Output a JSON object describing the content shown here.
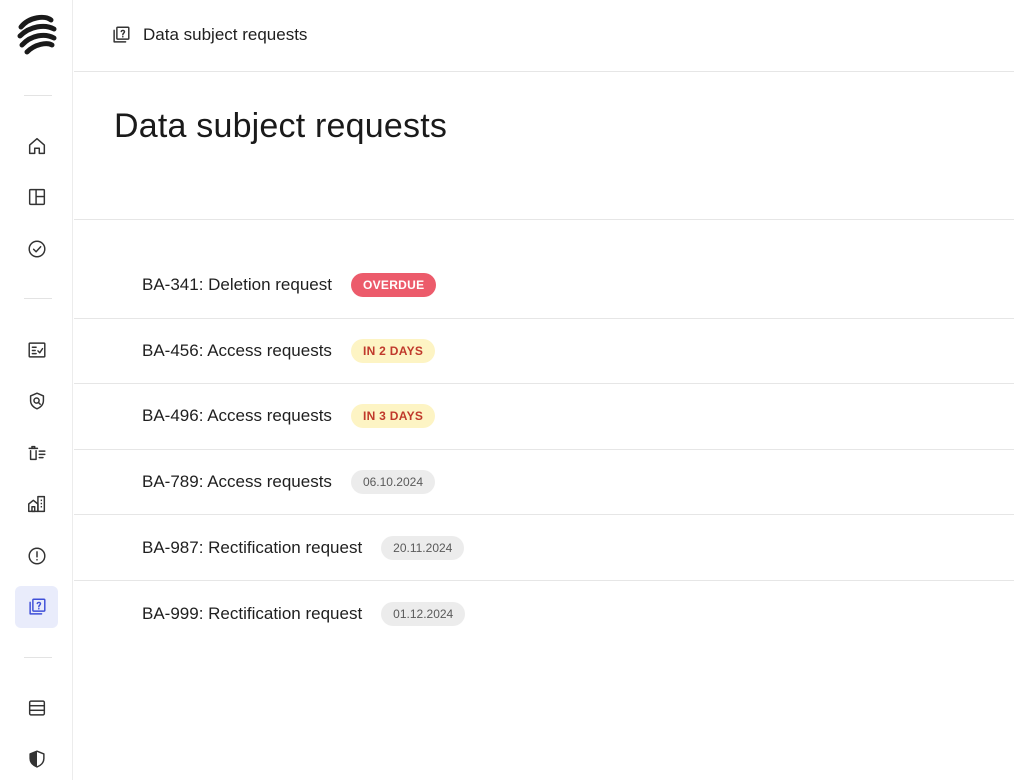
{
  "breadcrumb": {
    "label": "Data subject requests"
  },
  "page": {
    "title": "Data subject requests"
  },
  "colors": {
    "overdue_badge": "#ec5b6b",
    "soon_badge_bg": "#fdf4c4",
    "soon_badge_text": "#c0392b",
    "date_badge_bg": "#ececec",
    "active_nav_bg": "#e9ecfb",
    "accent": "#3f4fd8"
  },
  "sidebar": {
    "items": [
      {
        "icon": "home-icon"
      },
      {
        "icon": "layout-icon"
      },
      {
        "icon": "check-circle-icon"
      },
      {
        "icon": "checklist-icon"
      },
      {
        "icon": "shield-search-icon"
      },
      {
        "icon": "trash-list-icon"
      },
      {
        "icon": "buildings-icon"
      },
      {
        "icon": "alert-circle-icon"
      },
      {
        "icon": "question-box-icon",
        "active": true
      },
      {
        "icon": "database-icon"
      },
      {
        "icon": "shield-icon"
      }
    ]
  },
  "requests": [
    {
      "title": "BA-341: Deletion request",
      "badge": "OVERDUE",
      "badge_type": "overdue"
    },
    {
      "title": "BA-456: Access requests",
      "badge": "IN 2 DAYS",
      "badge_type": "soon"
    },
    {
      "title": "BA-496: Access requests",
      "badge": "IN 3 DAYS",
      "badge_type": "soon"
    },
    {
      "title": "BA-789: Access requests",
      "badge": "06.10.2024",
      "badge_type": "date"
    },
    {
      "title": "BA-987: Rectification request",
      "badge": "20.11.2024",
      "badge_type": "date"
    },
    {
      "title": "BA-999: Rectification request",
      "badge": "01.12.2024",
      "badge_type": "date"
    }
  ]
}
